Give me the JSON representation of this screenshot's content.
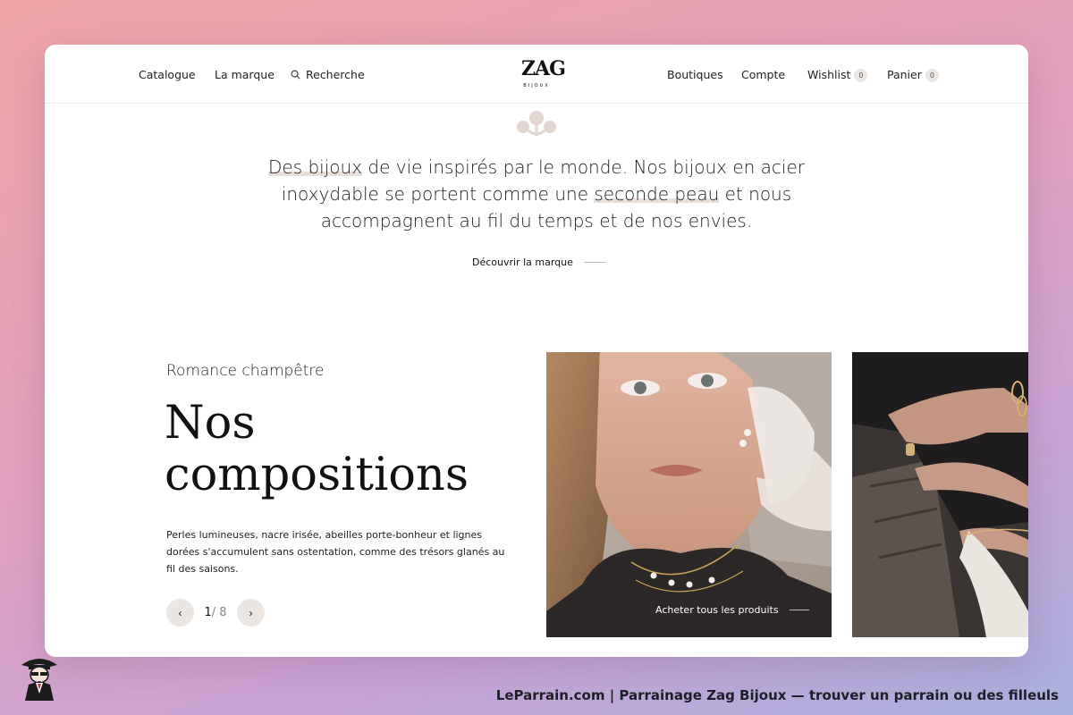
{
  "header": {
    "nav_left": [
      "Catalogue",
      "La marque"
    ],
    "search_label": "Recherche",
    "logo_text": "ZAG",
    "logo_sub": "BIJOUX",
    "nav_right": {
      "shops": "Boutiques",
      "account": "Compte",
      "wishlist": "Wishlist",
      "wishlist_count": "0",
      "cart": "Panier",
      "cart_count": "0"
    }
  },
  "intro": {
    "t1": "Des bijoux",
    "t2": " de vie inspirés par le monde. Nos bijoux en acier inoxydable se portent comme une ",
    "t3": "seconde peau",
    "t4": " et nous accompagnent au fil du temps et de nos envies.",
    "cta": "Découvrir la marque"
  },
  "collection": {
    "subtitle": "Romance champêtre",
    "title_line1": "Nos",
    "title_line2": "compositions",
    "description": "Perles lumineuses, nacre irisée, abeilles porte-bonheur et lignes dorées s'accumulent sans ostentation, comme des trésors glanés au fil des saisons.",
    "prev": "‹",
    "next": "›",
    "current_page": "1",
    "total_pages": "/ 8",
    "shop_all": "Acheter tous les produits"
  },
  "footer": {
    "caption": "LeParrain.com | Parrainage Zag Bijoux — trouver un parrain ou des filleuls"
  },
  "colors": {
    "accent_soft": "#ece6e3",
    "highlight": "#e8dfdb",
    "text": "#1c1c1c"
  }
}
